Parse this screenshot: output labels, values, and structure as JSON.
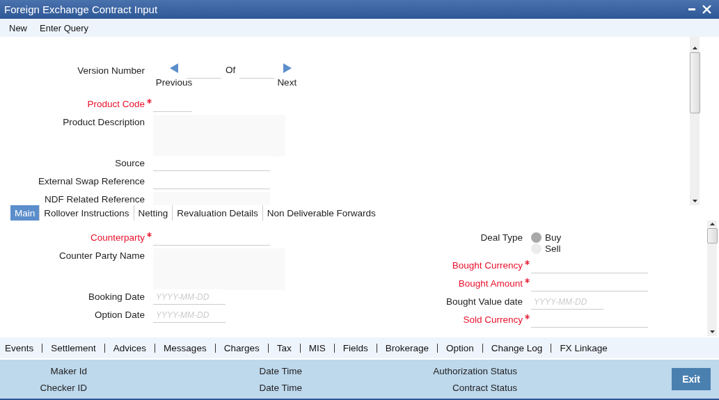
{
  "window": {
    "title": "Foreign Exchange Contract Input"
  },
  "menu": [
    "New",
    "Enter Query"
  ],
  "version": {
    "label": "Version Number",
    "of": "Of",
    "previous": "Previous",
    "next": "Next"
  },
  "header_fields": [
    {
      "label": "Product Code",
      "required": true,
      "kind": "short"
    },
    {
      "label": "Product Description",
      "required": false,
      "kind": "textarea"
    },
    {
      "label": "Source",
      "required": false,
      "kind": "text"
    },
    {
      "label": "External Swap Reference",
      "required": false,
      "kind": "text"
    },
    {
      "label": "NDF Related Reference",
      "required": false,
      "kind": "readonly"
    }
  ],
  "tabs": [
    {
      "label": "Main",
      "selected": true
    },
    {
      "label": "Rollover Instructions",
      "selected": false
    },
    {
      "label": "Netting",
      "selected": false
    },
    {
      "label": "Revaluation Details",
      "selected": false
    },
    {
      "label": "Non Deliverable Forwards",
      "selected": false
    }
  ],
  "main_left": [
    {
      "label": "Counterparty",
      "required": true,
      "kind": "text"
    },
    {
      "label": "Counter Party Name",
      "required": false,
      "kind": "textarea"
    },
    {
      "label": "Booking Date",
      "required": false,
      "kind": "date",
      "placeholder": "YYYY-MM-DD"
    },
    {
      "label": "Option Date",
      "required": false,
      "kind": "date",
      "placeholder": "YYYY-MM-DD"
    }
  ],
  "deal_type": {
    "label": "Deal Type",
    "options": [
      {
        "label": "Buy",
        "selected": true
      },
      {
        "label": "Sell",
        "selected": false
      }
    ]
  },
  "main_right": [
    {
      "label": "Bought Currency",
      "required": true,
      "kind": "text"
    },
    {
      "label": "Bought Amount",
      "required": true,
      "kind": "text"
    },
    {
      "label": "Bought Value date",
      "required": false,
      "kind": "date",
      "placeholder": "YYYY-MM-DD"
    },
    {
      "label": "Sold Currency",
      "required": true,
      "kind": "text"
    }
  ],
  "links": [
    "Events",
    "Settlement",
    "Advices",
    "Messages",
    "Charges",
    "Tax",
    "MIS",
    "Fields",
    "Brokerage",
    "Option",
    "Change Log",
    "FX Linkage"
  ],
  "footer": {
    "columns": [
      [
        "Maker Id",
        "Checker ID"
      ],
      [
        "Date Time",
        "Date Time"
      ],
      [
        "Authorization Status",
        "Contract Status"
      ]
    ],
    "exit": "Exit"
  }
}
